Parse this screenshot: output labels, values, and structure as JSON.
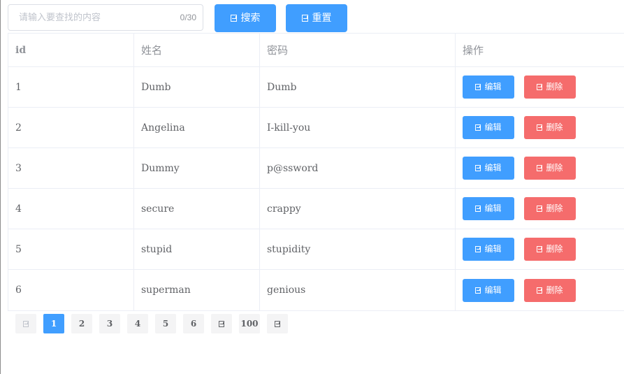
{
  "search": {
    "placeholder": "请输入要查找的内容",
    "value": "",
    "counter": "0/30",
    "search_label": "搜索",
    "reset_label": "重置"
  },
  "table": {
    "headers": [
      "id",
      "姓名",
      "密码",
      "操作"
    ],
    "rows": [
      {
        "id": "1",
        "name": "Dumb",
        "password": "Dumb"
      },
      {
        "id": "2",
        "name": "Angelina",
        "password": "I-kill-you"
      },
      {
        "id": "3",
        "name": "Dummy",
        "password": "p@ssword"
      },
      {
        "id": "4",
        "name": "secure",
        "password": "crappy"
      },
      {
        "id": "5",
        "name": "stupid",
        "password": "stupidity"
      },
      {
        "id": "6",
        "name": "superman",
        "password": "genious"
      }
    ],
    "edit_label": "编辑",
    "delete_label": "删除"
  },
  "pagination": {
    "pages": [
      "1",
      "2",
      "3",
      "4",
      "5",
      "6"
    ],
    "current": "1",
    "last": "100",
    "prev_icon": "chevron-left-icon",
    "more_icon": "ellipsis-icon",
    "next_icon": "chevron-right-icon"
  },
  "colors": {
    "primary": "#409eff",
    "danger": "#f56c6c",
    "border": "#ebeef5"
  }
}
